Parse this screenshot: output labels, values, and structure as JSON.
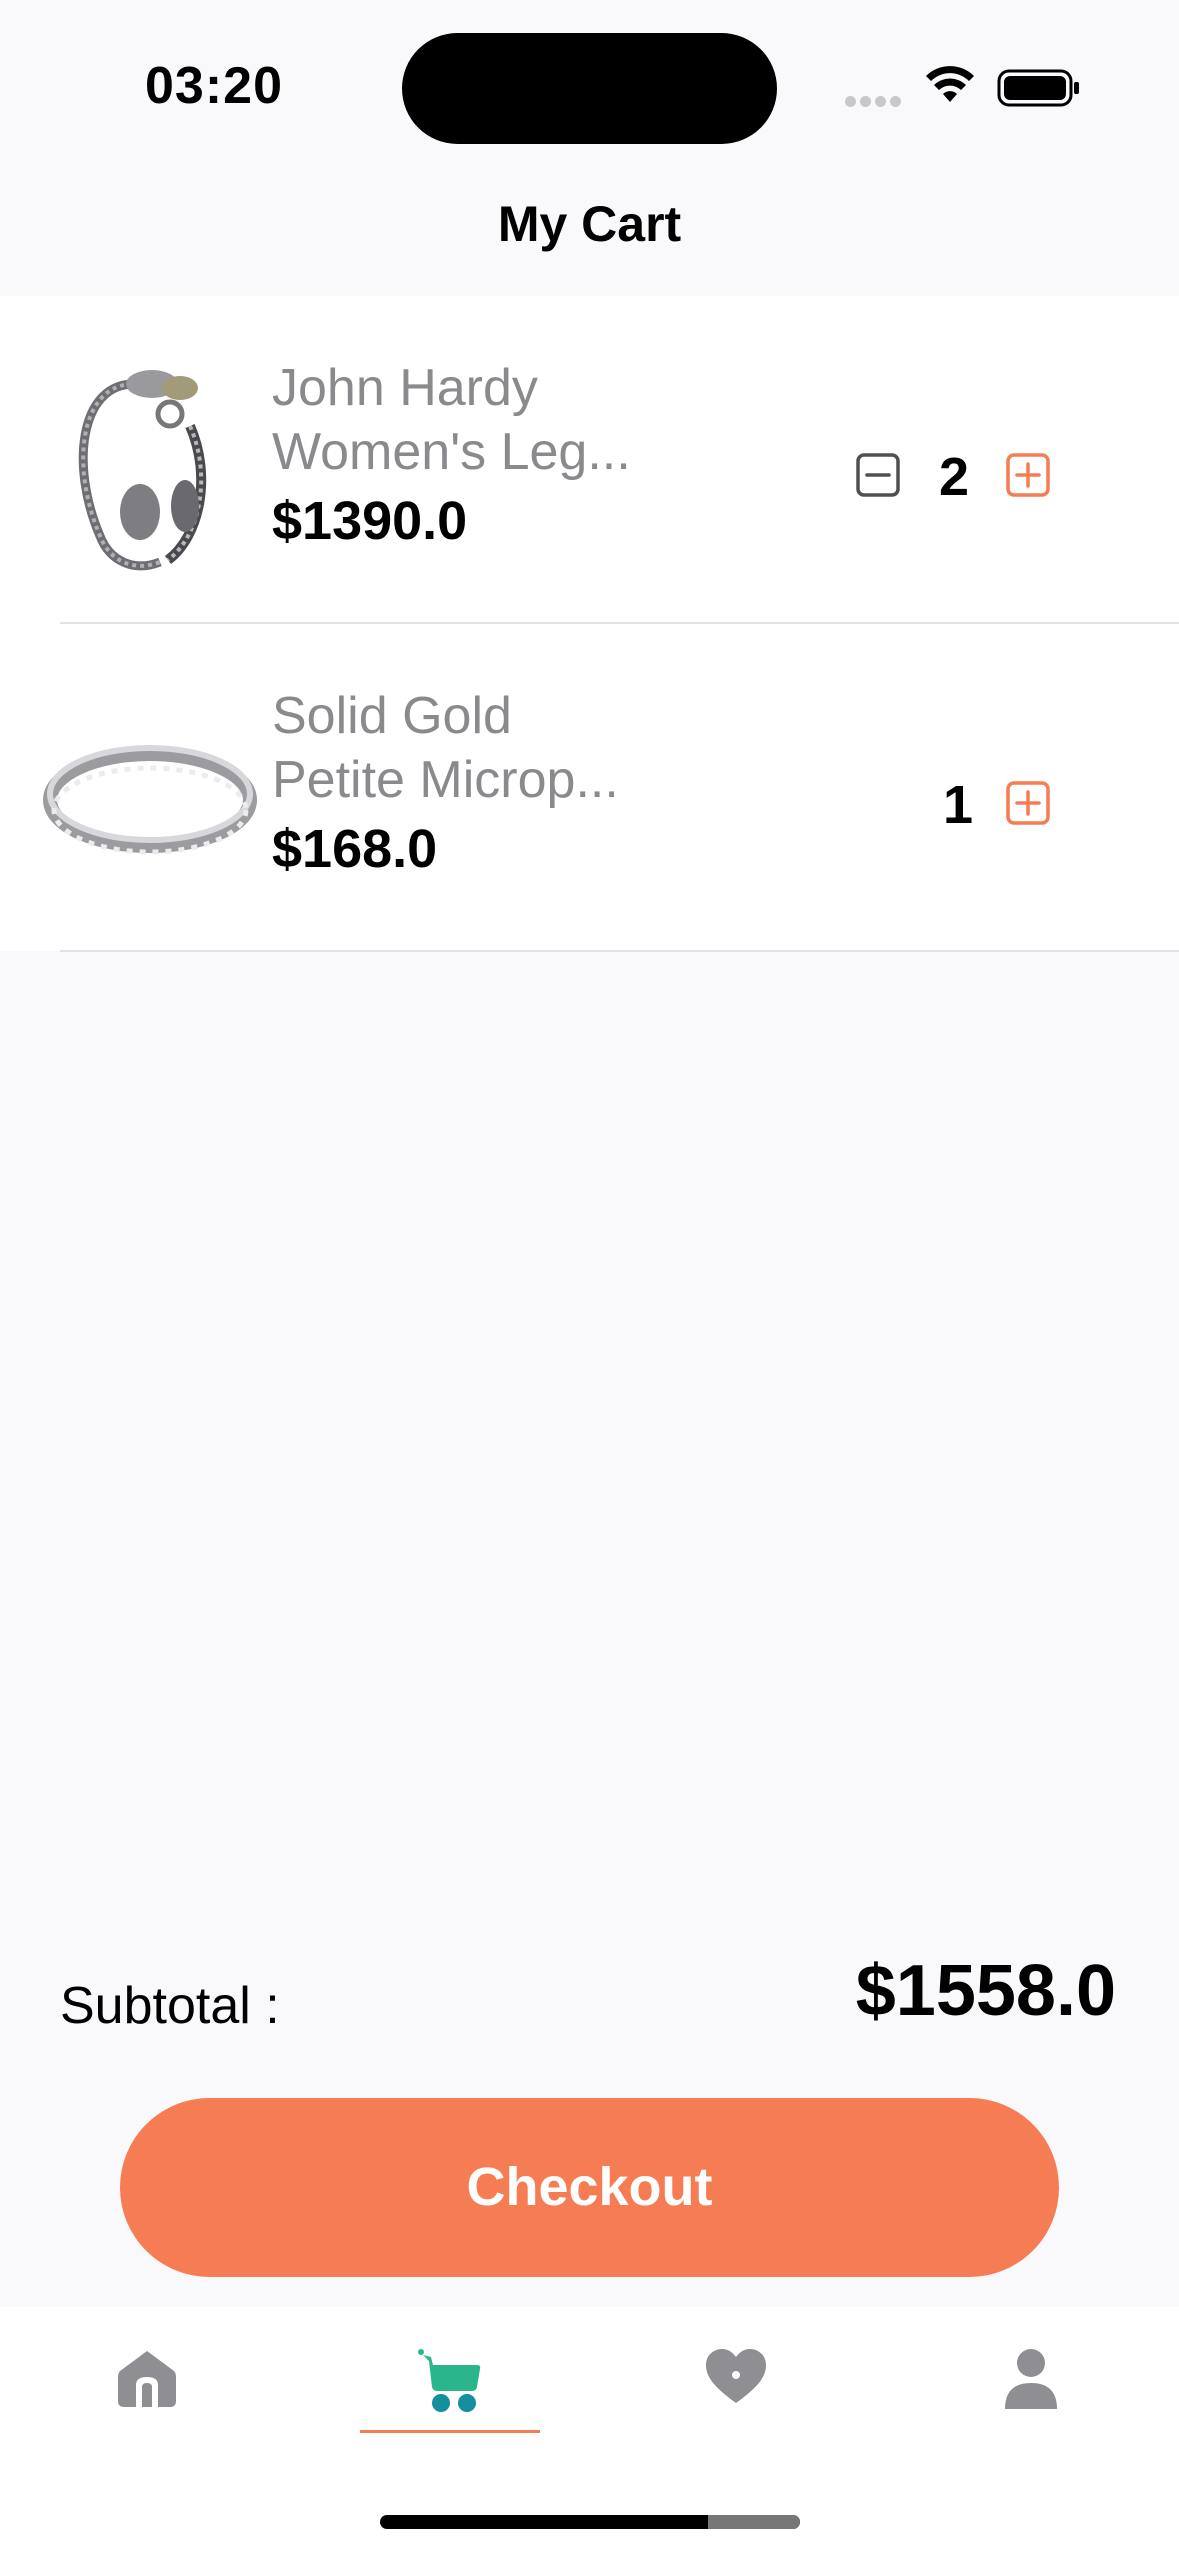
{
  "status_bar": {
    "time": "03:20"
  },
  "header": {
    "title": "My Cart"
  },
  "cart": {
    "items": [
      {
        "name_line1": "John Hardy",
        "name_line2": "Women's Leg...",
        "price": "$1390.0",
        "quantity": "2",
        "show_minus": true,
        "image": "silver-chain-bracelet"
      },
      {
        "name_line1": "Solid Gold",
        "name_line2": "Petite Microp...",
        "price": "$168.0",
        "quantity": "1",
        "show_minus": false,
        "image": "diamond-band-ring"
      }
    ]
  },
  "summary": {
    "subtotal_label": "Subtotal :",
    "subtotal_value": "$1558.0"
  },
  "checkout": {
    "label": "Checkout"
  },
  "tab_bar": {
    "tabs": [
      {
        "icon": "home-icon",
        "active": false
      },
      {
        "icon": "cart-icon",
        "active": true
      },
      {
        "icon": "heart-icon",
        "active": false
      },
      {
        "icon": "profile-icon",
        "active": false
      }
    ]
  },
  "colors": {
    "accent": "#f67c54",
    "cart_green": "#2bb58c",
    "cart_teal": "#138f9e",
    "muted_text": "#8a8a8e",
    "icon_gray": "#8e8e93"
  }
}
